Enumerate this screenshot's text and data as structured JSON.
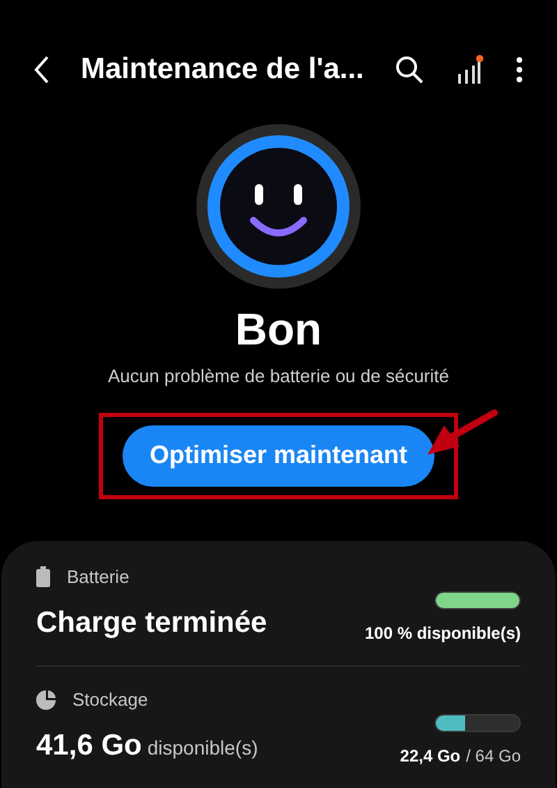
{
  "header": {
    "title": "Maintenance de l'a..."
  },
  "status": {
    "title": "Bon",
    "subtitle": "Aucun problème de batterie ou de sécurité"
  },
  "action": {
    "label": "Optimiser maintenant",
    "highlighted": true
  },
  "items": [
    {
      "kind": "battery",
      "label": "Batterie",
      "value": "Charge terminée",
      "level": 1.0,
      "color": "#7fd68a",
      "reading": "100 % disponible(s)"
    },
    {
      "kind": "storage",
      "label": "Stockage",
      "value": "41,6 Go",
      "value_note": "disponible(s)",
      "level": 0.35,
      "color": "#4fbcc2",
      "reading": "22,4 Go",
      "reading_note": "/ 64 Go"
    }
  ]
}
